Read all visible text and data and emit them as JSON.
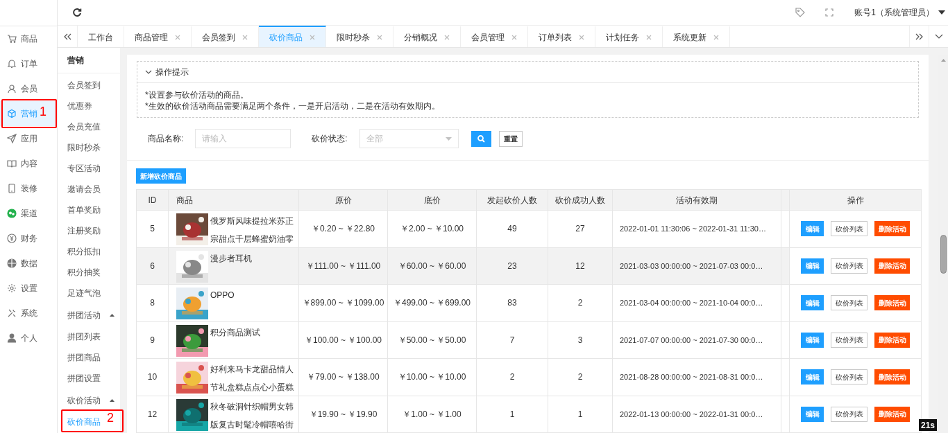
{
  "sidebar": {
    "items": [
      {
        "label": "商品",
        "selected": false
      },
      {
        "label": "订单",
        "selected": false
      },
      {
        "label": "会员",
        "selected": false
      },
      {
        "label": "营销",
        "selected": true
      },
      {
        "label": "应用",
        "selected": false
      },
      {
        "label": "内容",
        "selected": false
      },
      {
        "label": "装修",
        "selected": false
      },
      {
        "label": "渠道",
        "selected": false
      },
      {
        "label": "财务",
        "selected": false
      },
      {
        "label": "数据",
        "selected": false
      },
      {
        "label": "设置",
        "selected": false
      },
      {
        "label": "系统",
        "selected": false
      },
      {
        "label": "个人",
        "selected": false
      }
    ]
  },
  "topbar": {
    "account": "账号1（系统管理员）"
  },
  "tabs": [
    {
      "label": "工作台",
      "closable": false,
      "selected": false
    },
    {
      "label": "商品管理",
      "closable": true,
      "selected": false
    },
    {
      "label": "会员签到",
      "closable": true,
      "selected": false
    },
    {
      "label": "砍价商品",
      "closable": true,
      "selected": true
    },
    {
      "label": "限时秒杀",
      "closable": true,
      "selected": false
    },
    {
      "label": "分销概况",
      "closable": true,
      "selected": false
    },
    {
      "label": "会员管理",
      "closable": true,
      "selected": false
    },
    {
      "label": "订单列表",
      "closable": true,
      "selected": false
    },
    {
      "label": "计划任务",
      "closable": true,
      "selected": false
    },
    {
      "label": "系统更新",
      "closable": true,
      "selected": false
    }
  ],
  "submenu": {
    "title": "营销",
    "items": [
      {
        "label": "会员签到",
        "selected": false
      },
      {
        "label": "优惠券",
        "selected": false
      },
      {
        "label": "会员充值",
        "selected": false
      },
      {
        "label": "限时秒杀",
        "selected": false
      },
      {
        "label": "专区活动",
        "selected": false
      },
      {
        "label": "邀请会员",
        "selected": false
      },
      {
        "label": "首单奖励",
        "selected": false
      },
      {
        "label": "注册奖励",
        "selected": false
      },
      {
        "label": "积分抵扣",
        "selected": false
      },
      {
        "label": "积分抽奖",
        "selected": false
      },
      {
        "label": "足迹气泡",
        "selected": false
      },
      {
        "label": "拼团活动",
        "expanded": true,
        "children": [
          {
            "label": "拼团列表",
            "selected": false
          },
          {
            "label": "拼团商品",
            "selected": false
          },
          {
            "label": "拼团设置",
            "selected": false
          }
        ]
      },
      {
        "label": "砍价活动",
        "expanded": true,
        "children": [
          {
            "label": "砍价商品",
            "selected": true
          }
        ]
      }
    ]
  },
  "tips": {
    "title": "操作提示",
    "expanded": true,
    "lines": [
      "*设置参与砍价活动的商品。",
      "*生效的砍价活动商品需要满足两个条件，一是开启活动，二是在活动有效期内。"
    ]
  },
  "filters": {
    "name_label": "商品名称:",
    "name_placeholder": "请输入",
    "status_label": "砍价状态:",
    "status_value": "全部",
    "reset": "重置"
  },
  "add_button": "新增砍价商品",
  "table": {
    "columns": [
      "ID",
      "商品",
      "原价",
      "底价",
      "发起砍价人数",
      "砍价成功人数",
      "活动有效期",
      "操作"
    ],
    "rows": [
      {
        "id": "5",
        "product": "俄罗斯风味提拉米苏正宗甜点千层蜂蜜奶油零",
        "original_price": "￥0.20 ~ ￥22.80",
        "floor_price": "￥2.00 ~ ￥10.00",
        "initiated": "49",
        "succeeded": "27",
        "period": "2022-01-01 11:30:06 ~ 2022-01-31 11:30…",
        "highlighted": false,
        "actions": [
          "编辑",
          "砍价列表",
          "删除活动"
        ]
      },
      {
        "id": "6",
        "product": "漫步者耳机",
        "original_price": "￥111.00 ~ ￥111.00",
        "floor_price": "￥60.00 ~ ￥60.00",
        "initiated": "23",
        "succeeded": "12",
        "period": "2021-03-03 00:00:00 ~ 2021-07-03 00:0…",
        "highlighted": true,
        "actions": [
          "编辑",
          "砍价列表",
          "删除活动"
        ]
      },
      {
        "id": "8",
        "product": "OPPO",
        "original_price": "￥899.00 ~ ￥1099.00",
        "floor_price": "￥499.00 ~ ￥699.00",
        "initiated": "83",
        "succeeded": "2",
        "period": "2021-03-04 00:00:00 ~ 2021-10-04 00:0…",
        "highlighted": false,
        "actions": [
          "编辑",
          "砍价列表",
          "删除活动"
        ]
      },
      {
        "id": "9",
        "product": "积分商品测试",
        "original_price": "￥100.00 ~ ￥100.00",
        "floor_price": "￥50.00 ~ ￥50.00",
        "initiated": "7",
        "succeeded": "3",
        "period": "2021-07-07 00:00:00 ~ 2021-07-30 00:0…",
        "highlighted": false,
        "actions": [
          "编辑",
          "砍价列表",
          "删除活动"
        ]
      },
      {
        "id": "10",
        "product": "好利来马卡龙甜品情人节礼盒糕点点心小蛋糕",
        "original_price": "￥79.00 ~ ￥138.00",
        "floor_price": "￥10.00 ~ ￥10.00",
        "initiated": "2",
        "succeeded": "2",
        "period": "2021-08-28 00:00:00 ~ 2021-08-31 00:0…",
        "highlighted": false,
        "actions": [
          "编辑",
          "砍价列表",
          "删除活动"
        ]
      },
      {
        "id": "12",
        "product": "秋冬破洞针织帽男女韩版复古时髦冷帽嘻哈街",
        "original_price": "￥19.90 ~ ￥19.90",
        "floor_price": "￥1.00 ~ ￥1.00",
        "initiated": "1",
        "succeeded": "1",
        "period": "2022-01-13 00:00:00 ~ 2022-01-31 00:0…",
        "highlighted": false,
        "actions": [
          "编辑",
          "砍价列表",
          "删除活动"
        ]
      }
    ]
  },
  "annotations": [
    {
      "label": "1"
    },
    {
      "label": "2"
    }
  ],
  "corner_badge": "21s"
}
